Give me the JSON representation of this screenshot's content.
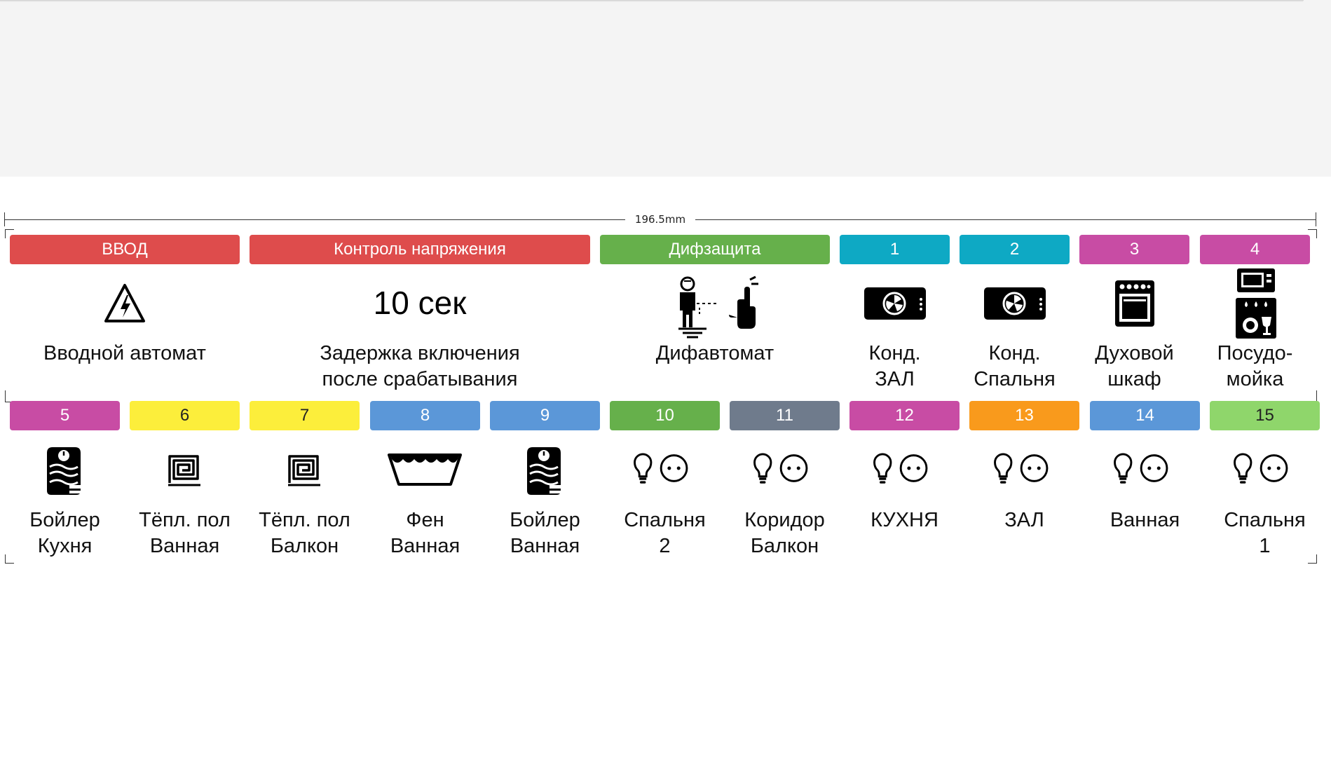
{
  "dimension": {
    "label": "196.5mm"
  },
  "colors": {
    "red": "#de4c4c",
    "green": "#66b04b",
    "cyan": "#0ea9c4",
    "magenta": "#c84ca4",
    "yellow": "#fcee3b",
    "blue": "#5b97d8",
    "gray": "#6f7b8c",
    "orange": "#f99a1c",
    "lightgreen": "#8fd66b"
  },
  "row1": {
    "tags": [
      {
        "label": "ВВОД",
        "color": "red"
      },
      {
        "label": "Контроль напряжения",
        "color": "red"
      },
      {
        "label": "Дифзащита",
        "color": "green"
      },
      {
        "label": "1",
        "color": "cyan"
      },
      {
        "label": "2",
        "color": "cyan"
      },
      {
        "label": "3",
        "color": "magenta"
      },
      {
        "label": "4",
        "color": "magenta"
      }
    ],
    "big_text": "10 сек",
    "captions": [
      {
        "line1": "Вводной автомат",
        "line2": ""
      },
      {
        "line1": "Задержка включения",
        "line2": "после срабатывания"
      },
      {
        "line1": "Дифавтомат",
        "line2": ""
      },
      {
        "line1": "Конд.",
        "line2": "ЗАЛ"
      },
      {
        "line1": "Конд.",
        "line2": "Спальня"
      },
      {
        "line1": "Духовой",
        "line2": "шкаф"
      },
      {
        "line1": "Посудо-",
        "line2": "мойка"
      }
    ],
    "icons": [
      "high-voltage-warning-icon",
      "differential-breaker-icon",
      "air-conditioner-icon",
      "air-conditioner-icon",
      "oven-icon",
      "microwave-icon",
      "dishwasher-icon"
    ]
  },
  "row2": {
    "tags": [
      {
        "label": "5",
        "color": "magenta"
      },
      {
        "label": "6",
        "color": "yellow"
      },
      {
        "label": "7",
        "color": "yellow"
      },
      {
        "label": "8",
        "color": "blue"
      },
      {
        "label": "9",
        "color": "blue"
      },
      {
        "label": "10",
        "color": "green"
      },
      {
        "label": "11",
        "color": "gray"
      },
      {
        "label": "12",
        "color": "magenta"
      },
      {
        "label": "13",
        "color": "orange"
      },
      {
        "label": "14",
        "color": "blue"
      },
      {
        "label": "15",
        "color": "lightgreen"
      }
    ],
    "captions": [
      {
        "line1": "Бойлер",
        "line2": "Кухня"
      },
      {
        "line1": "Тёпл. пол",
        "line2": "Ванная"
      },
      {
        "line1": "Тёпл. пол",
        "line2": "Балкон"
      },
      {
        "line1": "Фен",
        "line2": "Ванная"
      },
      {
        "line1": "Бойлер",
        "line2": "Ванная"
      },
      {
        "line1": "Спальня",
        "line2": "2"
      },
      {
        "line1": "Коридор",
        "line2": "Балкон"
      },
      {
        "line1": "КУХНЯ",
        "line2": ""
      },
      {
        "line1": "ЗАЛ",
        "line2": ""
      },
      {
        "line1": "Ванная",
        "line2": ""
      },
      {
        "line1": "Спальня",
        "line2": "1"
      }
    ],
    "icons": [
      "water-heater-icon",
      "floor-heating-icon",
      "floor-heating-icon",
      "hand-dryer-icon",
      "water-heater-icon",
      "bulb-socket-icon",
      "bulb-socket-icon",
      "bulb-socket-icon",
      "bulb-socket-icon",
      "bulb-socket-icon",
      "bulb-socket-icon"
    ]
  }
}
